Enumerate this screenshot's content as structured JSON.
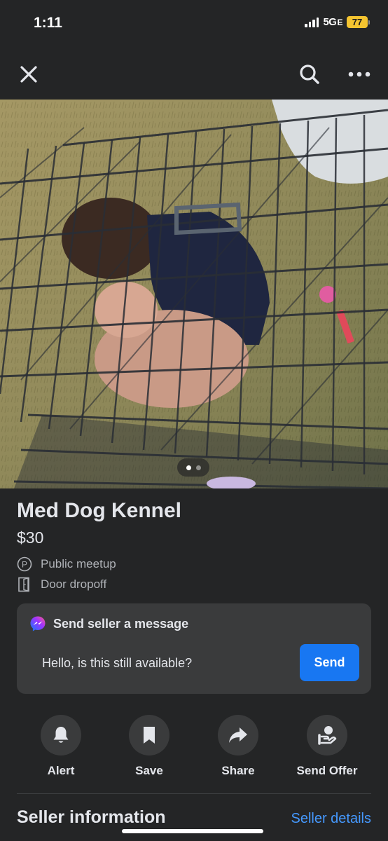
{
  "status": {
    "time": "1:11",
    "network": "5G",
    "network_suffix": "E",
    "battery": "77"
  },
  "nav": {
    "close_icon": "close-icon",
    "search_icon": "search-icon",
    "more_icon": "more-icon"
  },
  "photo": {
    "image_index": 1,
    "image_count": 2
  },
  "listing": {
    "title": "Med Dog Kennel",
    "price": "$30",
    "delivery": [
      {
        "icon": "parking-icon",
        "label": "Public meetup"
      },
      {
        "icon": "door-icon",
        "label": "Door dropoff"
      }
    ]
  },
  "message": {
    "heading": "Send seller a message",
    "input_value": "Hello, is this still available?",
    "send_label": "Send",
    "accent": "#1877f2"
  },
  "actions": [
    {
      "icon": "bell-icon",
      "label": "Alert"
    },
    {
      "icon": "bookmark-icon",
      "label": "Save"
    },
    {
      "icon": "share-icon",
      "label": "Share"
    },
    {
      "icon": "offer-icon",
      "label": "Send Offer"
    }
  ],
  "seller": {
    "heading": "Seller information",
    "link": "Seller details"
  },
  "colors": {
    "background": "#242526",
    "card": "#3a3b3c",
    "link": "#4599ff",
    "battery": "#f4c430"
  }
}
